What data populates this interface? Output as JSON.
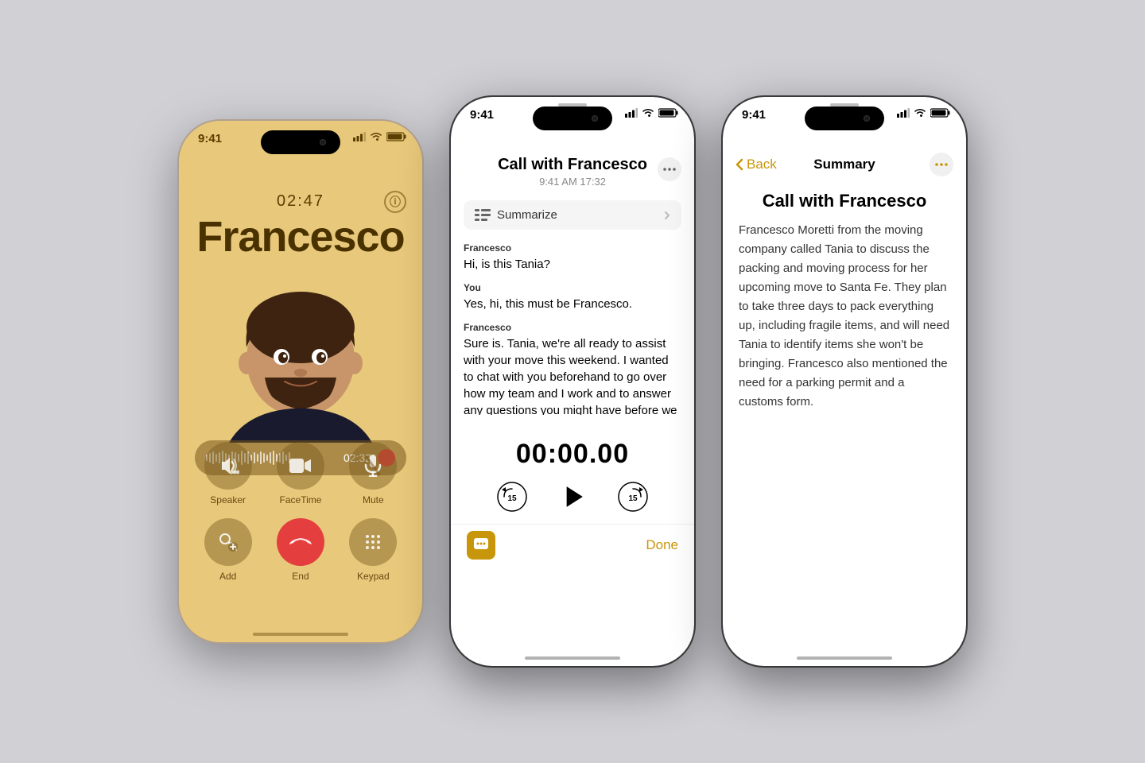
{
  "bg_color": "#d0d0d5",
  "phones": {
    "phone1": {
      "status_time": "9:41",
      "call_timer": "02:47",
      "caller_name": "Francesco",
      "info_btn": "ⓘ",
      "rec_timer": "02:32",
      "buttons": {
        "row1": [
          {
            "id": "speaker",
            "label": "Speaker"
          },
          {
            "id": "facetime",
            "label": "FaceTime"
          },
          {
            "id": "mute",
            "label": "Mute"
          }
        ],
        "row2": [
          {
            "id": "add",
            "label": "Add"
          },
          {
            "id": "end",
            "label": "End"
          },
          {
            "id": "keypad",
            "label": "Keypad"
          }
        ]
      }
    },
    "phone2": {
      "status_time": "9:41",
      "title": "Call with Francesco",
      "subtitle": "9:41 AM  17:32",
      "more_btn": "•••",
      "summarize_label": "Summarize",
      "transcript": [
        {
          "speaker": "Francesco",
          "text": "Hi, is this Tania?"
        },
        {
          "speaker": "You",
          "text": "Yes, hi, this must be Francesco."
        },
        {
          "speaker": "Francesco",
          "text": "Sure is. Tania, we're all ready to assist with your move this weekend. I wanted to chat with you beforehand to go over how my team and I work and to answer any questions you might have before we arrive Saturday"
        }
      ],
      "timer": "00:00.00",
      "done_label": "Done"
    },
    "phone3": {
      "status_time": "9:41",
      "back_label": "Back",
      "nav_title": "Summary",
      "more_btn": "•••",
      "summary_title": "Call with Francesco",
      "summary_text": "Francesco Moretti from the moving company called Tania to discuss the packing and moving process for her upcoming move to Santa Fe. They plan to take three days to pack everything up, including fragile items, and will need Tania to identify items she won't be bringing. Francesco also mentioned the need for a parking permit and a customs form."
    }
  },
  "accent_color": "#c8960a",
  "waveform_heights": [
    8,
    12,
    16,
    10,
    14,
    18,
    12,
    8,
    16,
    14,
    10,
    18,
    12,
    16,
    8,
    14,
    10,
    16,
    12,
    8,
    14,
    18,
    10,
    12,
    16,
    8,
    14
  ]
}
